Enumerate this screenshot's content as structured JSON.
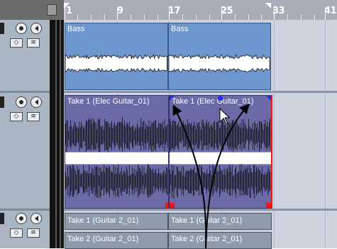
{
  "ruler": {
    "markers": [
      "1",
      "9",
      "17",
      "25",
      "33",
      "41"
    ]
  },
  "tracks": [
    {
      "name": "track-bass"
    },
    {
      "name": "track-guitar"
    },
    {
      "name": "track-guitar2"
    }
  ],
  "events": {
    "bass_1": "Bass",
    "bass_2": "Bass",
    "guitar_1": "Take 1 (Elec Guitar_01)",
    "guitar_2": "Take 1 (Elec Guitar_01)",
    "g2_1": "Take 1 (Guitar 2_01)",
    "g2_2": "Take 1 (Guitar 2_01)",
    "g2_3": "Take 2 (Guitar 2_01)",
    "g2_4": "Take 2 (Guitar 2_01)"
  },
  "colors": {
    "bass_event": "#6e96cf",
    "guitar_event": "#6c6aa6",
    "guitar2_event": "#8f9aaa",
    "selection_corner": "#ff1010",
    "fade_handle": "#1d2bff"
  },
  "icons": [
    "record-icon",
    "monitor-icon",
    "track-settings-icon",
    "edit-icon",
    "arrow-cursor-icon"
  ]
}
